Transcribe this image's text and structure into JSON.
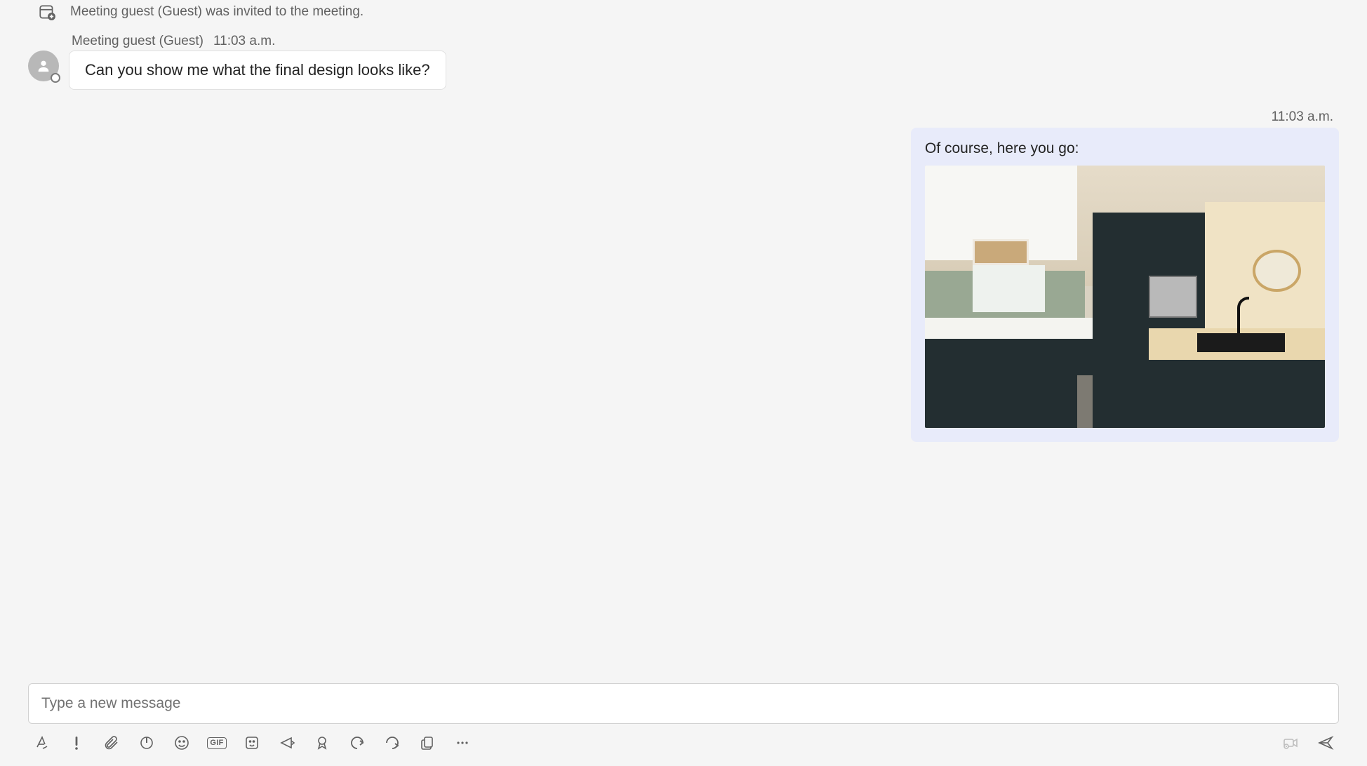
{
  "system_event": {
    "text": "Meeting guest (Guest) was invited to the meeting."
  },
  "incoming": {
    "sender": "Meeting guest (Guest)",
    "time": "11:03 a.m.",
    "body": "Can you show me what the final design looks like?"
  },
  "outgoing": {
    "time": "11:03 a.m.",
    "body": "Of course, here you go:",
    "attachment_alt": "kitchen-design-image"
  },
  "compose": {
    "placeholder": "Type a new message"
  },
  "toolbar": {
    "gif_label": "GIF"
  }
}
